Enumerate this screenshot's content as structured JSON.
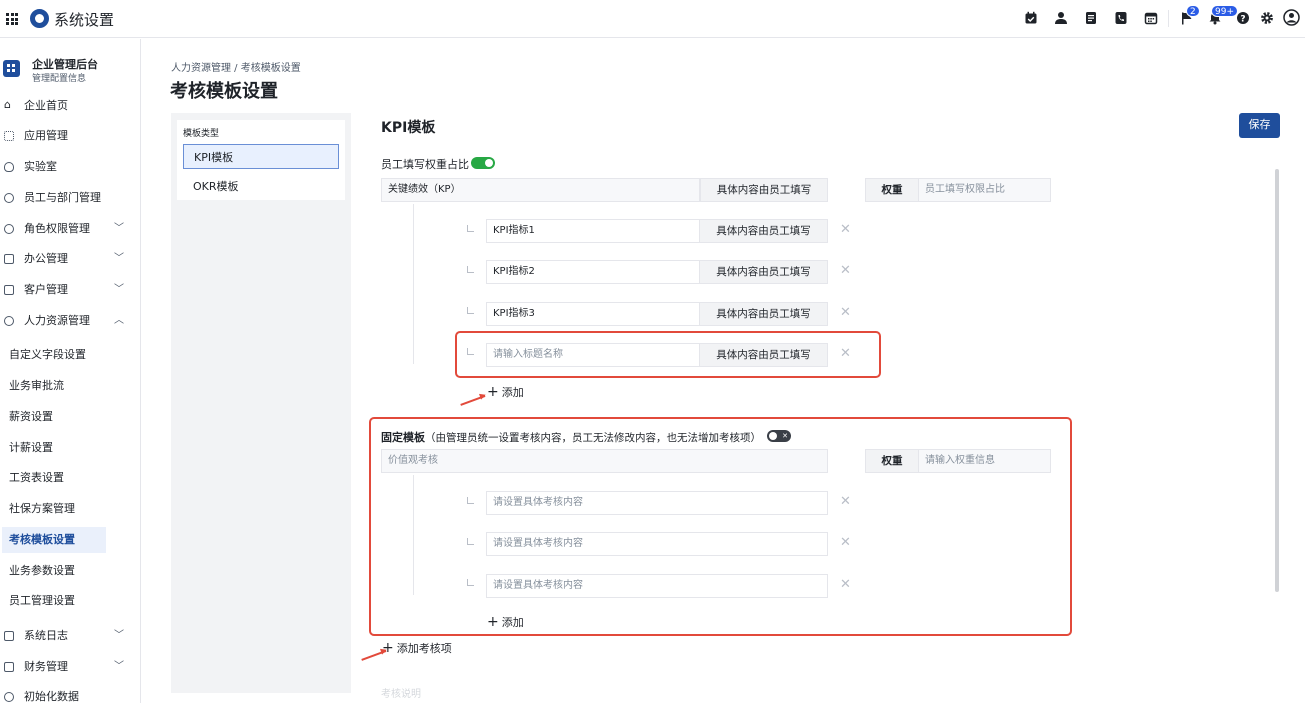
{
  "app": {
    "title": "系统设置"
  },
  "top_icons": [
    {
      "name": "calendar-check-icon"
    },
    {
      "name": "user-icon"
    },
    {
      "name": "document-icon"
    },
    {
      "name": "phone-icon"
    },
    {
      "name": "calendar-icon"
    },
    {
      "name": "flag-icon",
      "badge": "2"
    },
    {
      "name": "bell-icon",
      "badge": "99+"
    },
    {
      "name": "help-icon"
    },
    {
      "name": "gear-icon"
    },
    {
      "name": "avatar-icon"
    }
  ],
  "sidebar": {
    "org_name": "企业管理后台",
    "org_sub": "管理配置信息",
    "items": [
      {
        "label": "企业首页",
        "chevron": ""
      },
      {
        "label": "应用管理",
        "chevron": ""
      },
      {
        "label": "实验室",
        "chevron": ""
      },
      {
        "label": "员工与部门管理",
        "chevron": ""
      },
      {
        "label": "角色权限管理",
        "chevron": "﹀"
      },
      {
        "label": "办公管理",
        "chevron": "﹀"
      },
      {
        "label": "客户管理",
        "chevron": "﹀"
      },
      {
        "label": "人力资源管理",
        "chevron": "︿"
      }
    ],
    "sub_items": [
      "自定义字段设置",
      "业务审批流",
      "薪资设置",
      "计薪设置",
      "工资表设置",
      "社保方案管理",
      "考核模板设置",
      "业务参数设置",
      "员工管理设置"
    ],
    "bottom_items": [
      {
        "label": "系统日志",
        "chevron": "﹀"
      },
      {
        "label": "财务管理",
        "chevron": "﹀"
      },
      {
        "label": "初始化数据",
        "chevron": ""
      }
    ]
  },
  "breadcrumb": "人力资源管理  /  考核模板设置",
  "page_title": "考核模板设置",
  "template_types": {
    "label": "模板类型",
    "options": [
      "KPI模板",
      "OKR模板"
    ],
    "selected": "KPI模板"
  },
  "content": {
    "title": "KPI模板",
    "save_label": "保存",
    "weight_toggle_label": "员工填写权重占比",
    "weight_toggle_on": true,
    "kp_row": {
      "name": "关键绩效（KP）",
      "addon": "具体内容由员工填写",
      "weight_label": "权重",
      "weight_placeholder": "员工填写权限占比"
    },
    "kpi_items": [
      {
        "name": "KPI指标1",
        "addon": "具体内容由员工填写"
      },
      {
        "name": "KPI指标2",
        "addon": "具体内容由员工填写"
      },
      {
        "name": "KPI指标3",
        "addon": "具体内容由员工填写"
      }
    ],
    "new_item": {
      "placeholder": "请输入标题名称",
      "addon": "具体内容由员工填写"
    },
    "add_label": "添加",
    "fixed": {
      "title": "固定模板",
      "desc": "（由管理员统一设置考核内容，员工无法修改内容，也无法增加考核项）",
      "toggle_on": false,
      "name_placeholder": "价值观考核",
      "weight_label": "权重",
      "weight_placeholder": "请输入权重信息",
      "item_placeholders": [
        "请设置具体考核内容",
        "请设置具体考核内容",
        "请设置具体考核内容"
      ],
      "add_label": "添加"
    },
    "add_item_label": "添加考核项",
    "cut_text": "考核说明"
  },
  "colors": {
    "accent": "#1f4e9c",
    "highlight": "#e24a3b",
    "toggle_on": "#27a844"
  }
}
